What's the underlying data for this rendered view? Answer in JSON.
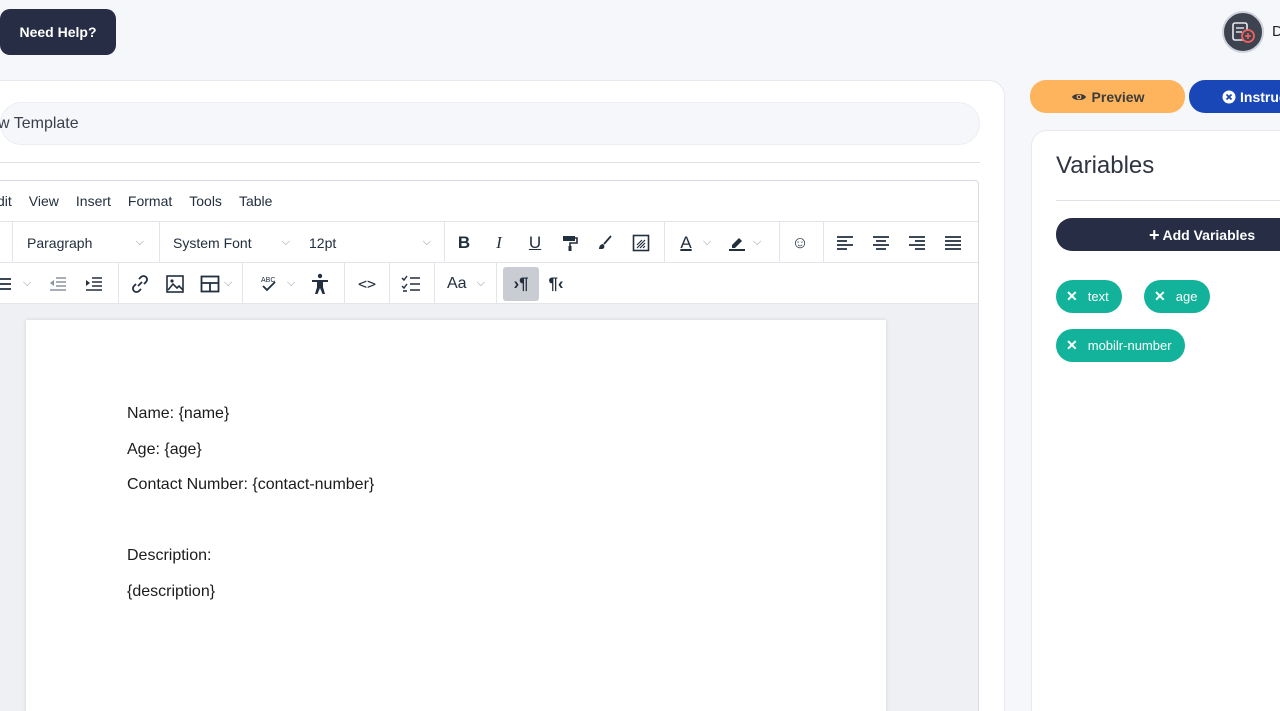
{
  "header": {
    "help_label": "Need Help?",
    "user_initial": "D"
  },
  "template": {
    "name_value": "w Template"
  },
  "editor": {
    "menu": [
      "dit",
      "View",
      "Insert",
      "Format",
      "Tools",
      "Table"
    ],
    "toolbar": {
      "block_format": "Paragraph",
      "font_family": "System Font",
      "font_size": "12pt",
      "font_case": "Aa"
    },
    "content": [
      "Name: {name}",
      "Age: {age}",
      "Contact Number: {contact-number}",
      "Description:",
      "{description}"
    ]
  },
  "sidebar": {
    "preview_label": "Preview",
    "instructions_label": "Instruc",
    "variables_title": "Variables",
    "add_variables_label": "Add Variables",
    "variables": [
      "text",
      "age",
      "mobilr-number"
    ]
  },
  "colors": {
    "dark": "#262d45",
    "preview": "#fdb45c",
    "instructions": "#1a47b8",
    "chip": "#12b39a"
  }
}
